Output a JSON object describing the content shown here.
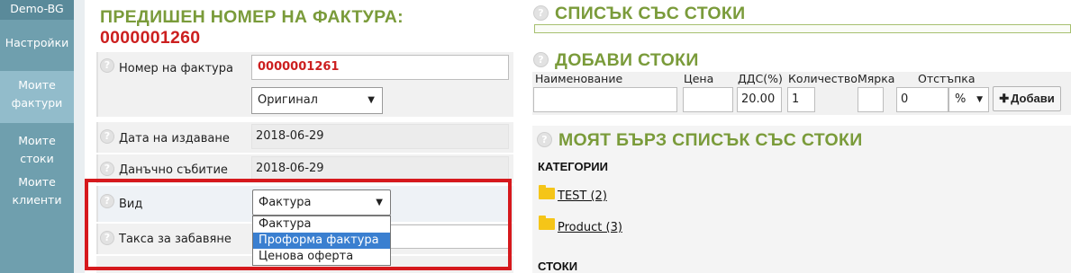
{
  "sidebar": {
    "company": "Demo-BG",
    "items": [
      {
        "label_lines": [
          "Настройки"
        ]
      },
      {
        "label_lines": [
          "Моите",
          "фактури"
        ]
      },
      {
        "label_lines": [
          "Моите стоки"
        ]
      },
      {
        "label_lines": [
          "Моите",
          "клиенти"
        ]
      }
    ]
  },
  "invoice": {
    "previous_title": "ПРЕДИШЕН НОМЕР НА ФАКТУРА:",
    "previous_number": "0000001260",
    "number_label": "Номер на фактура",
    "number_value": "0000001261",
    "copy_type": "Оригинал",
    "issue_date_label": "Дата на издаване",
    "issue_date": "2018-06-29",
    "tax_event_label": "Данъчно събитие",
    "tax_event_date": "2018-06-29",
    "type_label": "Вид",
    "type_selected": "Фактура",
    "type_options": [
      "Фактура",
      "Проформа фактура",
      "Ценова оферта"
    ],
    "late_fee_label": "Такса за забавяне"
  },
  "products_list": {
    "title": "СПИСЪК СЪС СТОКИ"
  },
  "add_products": {
    "title": "ДОБАВИ СТОКИ",
    "columns": {
      "name": "Наименование",
      "price": "Цена",
      "vat": "ДДС(%)",
      "quantity": "Количество",
      "unit": "Мярка",
      "discount": "Отстъпка"
    },
    "values": {
      "name": "",
      "price": "",
      "vat": "20.00",
      "quantity": "1",
      "unit": "",
      "discount": "0",
      "discount_type": "%"
    },
    "add_button": "Добави"
  },
  "quick_list": {
    "title": "МОЯТ БЪРЗ СПИСЪК СЪС СТОКИ",
    "categories_header": "КАТЕГОРИИ",
    "categories": [
      {
        "label": "TEST (2)"
      },
      {
        "label": "Product (3)"
      }
    ],
    "products_header": "СТОКИ"
  },
  "colors": {
    "section_title": "#7a9b3a",
    "invoice_number": "#cc1f1f",
    "sidebar": "#6f9fae",
    "highlight": "#d6191d",
    "selected_option": "#3a7fd0"
  }
}
